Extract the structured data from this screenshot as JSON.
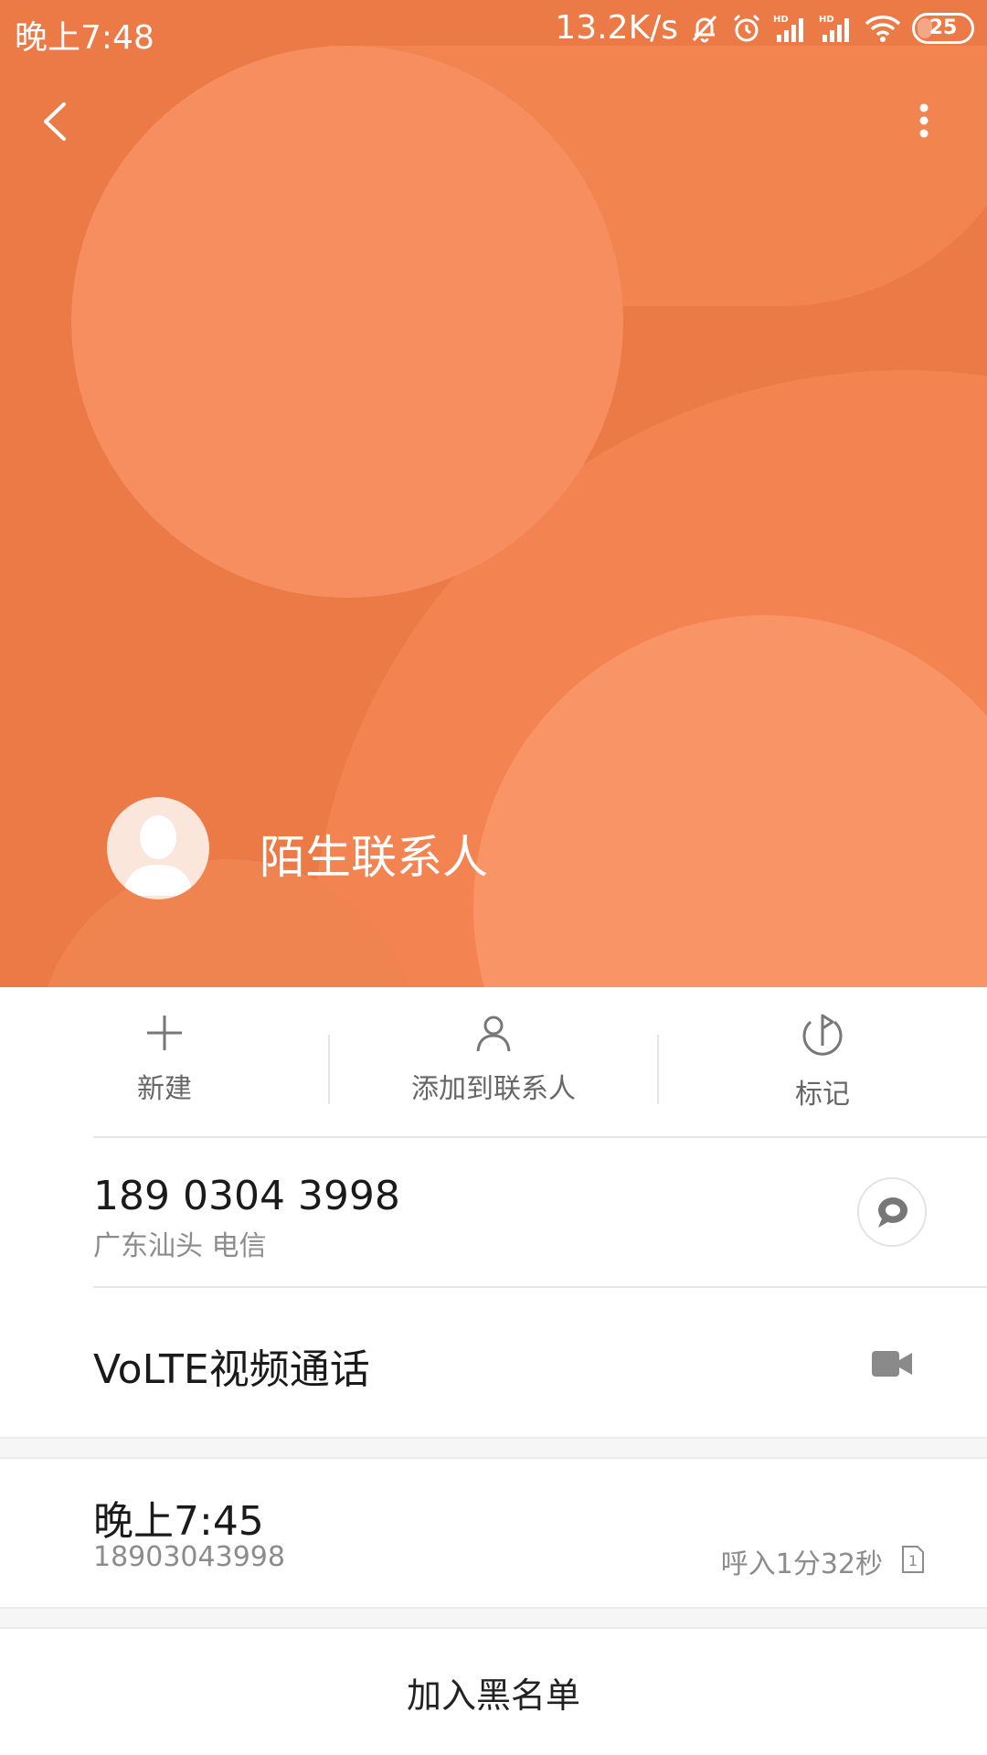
{
  "status_bar": {
    "time": "晚上7:48",
    "network_speed": "13.2K/s",
    "battery_level": "25",
    "battery_fraction": 0.25,
    "icons": [
      "mute-icon",
      "alarm-icon",
      "hd-signal-icon",
      "hd-signal-icon",
      "wifi-icon",
      "battery-icon"
    ]
  },
  "header": {
    "back_icon": "chevron-left-icon",
    "more_icon": "more-vertical-icon",
    "contact_name": "陌生联系人",
    "avatar_icon": "person-silhouette-icon",
    "accent_color": "#EB7A46"
  },
  "actions": [
    {
      "id": "new",
      "label": "新建",
      "icon": "plus-icon"
    },
    {
      "id": "add",
      "label": "添加到联系人",
      "icon": "person-icon"
    },
    {
      "id": "mark",
      "label": "标记",
      "icon": "flag-icon"
    }
  ],
  "phone": {
    "number": "189 0304 3998",
    "location": "广东汕头 电信",
    "sms_icon": "message-bubble-icon"
  },
  "volte": {
    "label": "VoLTE视频通话",
    "icon": "video-camera-icon"
  },
  "call_log": {
    "time": "晚上7:45",
    "number": "18903043998",
    "detail": "呼入1分32秒",
    "sim_label": "1"
  },
  "blacklist": {
    "label": "加入黑名单"
  }
}
